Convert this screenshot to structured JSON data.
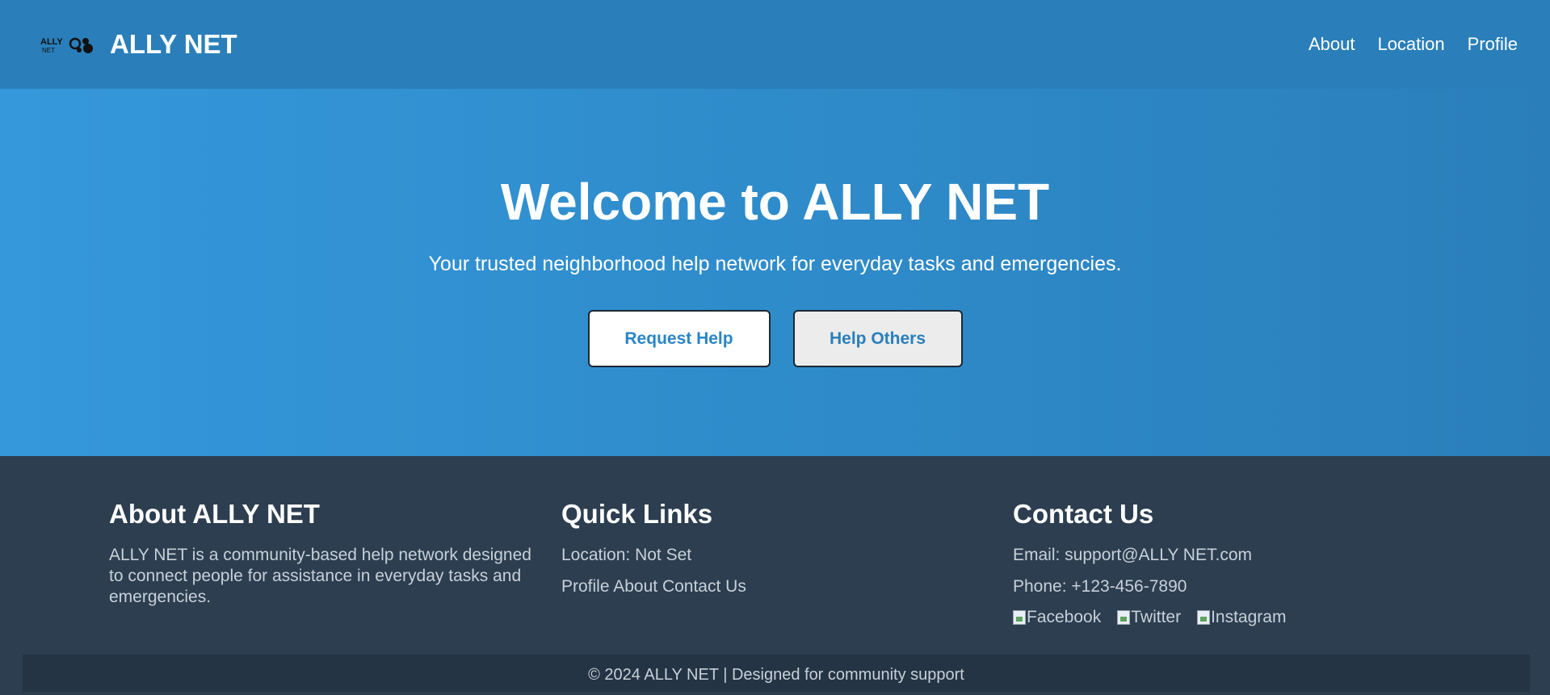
{
  "navbar": {
    "logo_text": "ALLY NET",
    "brand": "ALLY NET",
    "links": [
      "About",
      "Location",
      "Profile"
    ]
  },
  "hero": {
    "title": "Welcome to ALLY NET",
    "subtitle": "Your trusted neighborhood help network for everyday tasks and emergencies.",
    "primary_button": "Request Help",
    "secondary_button": "Help Others"
  },
  "footer": {
    "about": {
      "heading": "About ALLY NET",
      "text": "ALLY NET is a community-based help network designed to connect people for assistance in everyday tasks and emergencies."
    },
    "quick_links": {
      "heading": "Quick Links",
      "location": "Location: Not Set",
      "links": [
        "Profile",
        "About",
        "Contact Us"
      ]
    },
    "contact": {
      "heading": "Contact Us",
      "email": "Email: support@ALLY NET.com",
      "phone": "Phone: +123-456-7890",
      "social": [
        "Facebook",
        "Twitter",
        "Instagram"
      ]
    },
    "copyright": "© 2024 ALLY NET | Designed for community support"
  }
}
